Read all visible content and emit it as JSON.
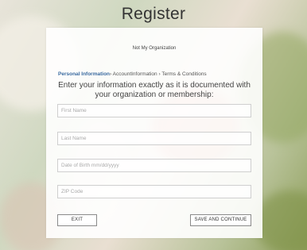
{
  "header": {
    "title": "Register"
  },
  "organization": {
    "link_label": "Not My Organization"
  },
  "breadcrumb": {
    "step1": "Personal Information",
    "sep1": "› ",
    "step2": "AccountInformation",
    "sep2": " › ",
    "step3": "Terms & Conditions"
  },
  "form": {
    "instructions": "Enter your information exactly as it is documented with your organization or membership:",
    "first_name_placeholder": "First Name",
    "last_name_placeholder": "Last Name",
    "dob_placeholder": "Date of Birth  mm/dd/yyyy",
    "zip_placeholder": "ZIP Code"
  },
  "actions": {
    "exit_label": "EXIT",
    "save_label": "SAVE AND CONTINUE"
  },
  "colors": {
    "accent": "#3a6aa0"
  }
}
